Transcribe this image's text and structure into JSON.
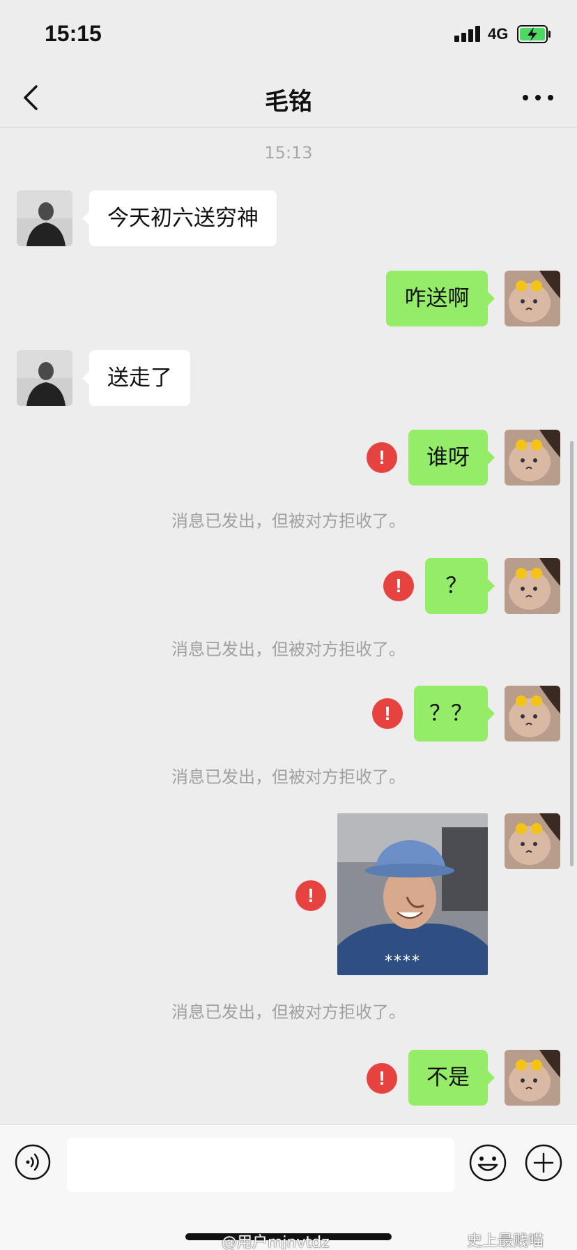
{
  "status_bar": {
    "time": "15:15",
    "network": "4G"
  },
  "nav": {
    "title": "毛铭"
  },
  "chat": {
    "timestamp": "15:13",
    "rejected_note": "消息已发出，但被对方拒收了。",
    "messages": [
      {
        "direction": "incoming",
        "text": "今天初六送穷神"
      },
      {
        "direction": "outgoing",
        "text": "咋送啊"
      },
      {
        "direction": "incoming",
        "text": "送走了"
      },
      {
        "direction": "outgoing",
        "text": "谁呀",
        "failed": true
      },
      {
        "direction": "outgoing",
        "text": "？",
        "failed": true
      },
      {
        "direction": "outgoing",
        "text": "？？",
        "failed": true
      },
      {
        "direction": "outgoing",
        "type": "sticker",
        "caption": "****",
        "failed": true
      },
      {
        "direction": "outgoing",
        "text": "不是",
        "failed": true
      }
    ],
    "error_mark": "!"
  },
  "input_bar": {
    "placeholder": ""
  },
  "watermarks": {
    "weibo": "@用户mjnvtdz",
    "account": "史上最贱喵"
  },
  "colors": {
    "background": "#ededed",
    "outgoing_bubble": "#95ec69",
    "incoming_bubble": "#ffffff",
    "error": "#e64340"
  },
  "icons": [
    "back-arrow-icon",
    "more-dots-icon",
    "voice-icon",
    "emoji-icon",
    "plus-icon",
    "error-icon",
    "signal-icon",
    "battery-icon"
  ]
}
